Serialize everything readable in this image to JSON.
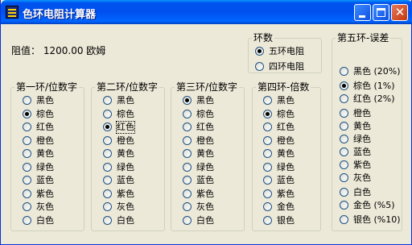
{
  "app": {
    "title": "色环电阻计算器"
  },
  "result": {
    "label": "阻值：",
    "value": "1200.00",
    "unit": "欧姆"
  },
  "ring_count": {
    "legend": "环数",
    "options": [
      {
        "label": "五环电阻",
        "selected": true
      },
      {
        "label": "四环电阻",
        "selected": false
      }
    ]
  },
  "band1": {
    "legend": "第一环/位数字",
    "options": [
      {
        "label": "黑色",
        "selected": false
      },
      {
        "label": "棕色",
        "selected": true
      },
      {
        "label": "红色",
        "selected": false
      },
      {
        "label": "橙色",
        "selected": false
      },
      {
        "label": "黄色",
        "selected": false
      },
      {
        "label": "绿色",
        "selected": false
      },
      {
        "label": "蓝色",
        "selected": false
      },
      {
        "label": "紫色",
        "selected": false
      },
      {
        "label": "灰色",
        "selected": false
      },
      {
        "label": "白色",
        "selected": false
      }
    ]
  },
  "band2": {
    "legend": "第二环/位数字",
    "options": [
      {
        "label": "黑色",
        "selected": false
      },
      {
        "label": "棕色",
        "selected": false
      },
      {
        "label": "红色",
        "selected": true
      },
      {
        "label": "橙色",
        "selected": false
      },
      {
        "label": "黄色",
        "selected": false
      },
      {
        "label": "绿色",
        "selected": false
      },
      {
        "label": "蓝色",
        "selected": false
      },
      {
        "label": "紫色",
        "selected": false
      },
      {
        "label": "灰色",
        "selected": false
      },
      {
        "label": "白色",
        "selected": false
      }
    ]
  },
  "band3": {
    "legend": "第三环/位数字",
    "options": [
      {
        "label": "黑色",
        "selected": true
      },
      {
        "label": "棕色",
        "selected": false
      },
      {
        "label": "红色",
        "selected": false
      },
      {
        "label": "橙色",
        "selected": false
      },
      {
        "label": "黄色",
        "selected": false
      },
      {
        "label": "绿色",
        "selected": false
      },
      {
        "label": "蓝色",
        "selected": false
      },
      {
        "label": "紫色",
        "selected": false
      },
      {
        "label": "灰色",
        "selected": false
      },
      {
        "label": "白色",
        "selected": false
      }
    ]
  },
  "band4": {
    "legend": "第四环-倍数",
    "options": [
      {
        "label": "黑色",
        "selected": false
      },
      {
        "label": "棕色",
        "selected": true
      },
      {
        "label": "红色",
        "selected": false
      },
      {
        "label": "橙色",
        "selected": false
      },
      {
        "label": "黄色",
        "selected": false
      },
      {
        "label": "绿色",
        "selected": false
      },
      {
        "label": "蓝色",
        "selected": false
      },
      {
        "label": "紫色",
        "selected": false
      },
      {
        "label": "金色",
        "selected": false
      },
      {
        "label": "银色",
        "selected": false
      }
    ]
  },
  "band5": {
    "legend": "第五环-误差",
    "options": [
      {
        "label": "黑色 (20%)",
        "selected": false
      },
      {
        "label": "棕色 (1%)",
        "selected": true
      },
      {
        "label": "红色 (2%)",
        "selected": false
      },
      {
        "label": "橙色",
        "selected": false
      },
      {
        "label": "黄色",
        "selected": false
      },
      {
        "label": "绿色",
        "selected": false
      },
      {
        "label": "蓝色",
        "selected": false
      },
      {
        "label": "紫色",
        "selected": false
      },
      {
        "label": "灰色",
        "selected": false
      },
      {
        "label": "白色",
        "selected": false
      },
      {
        "label": "金色 (%5)",
        "selected": false
      },
      {
        "label": "银色 (%10)",
        "selected": false
      }
    ]
  }
}
